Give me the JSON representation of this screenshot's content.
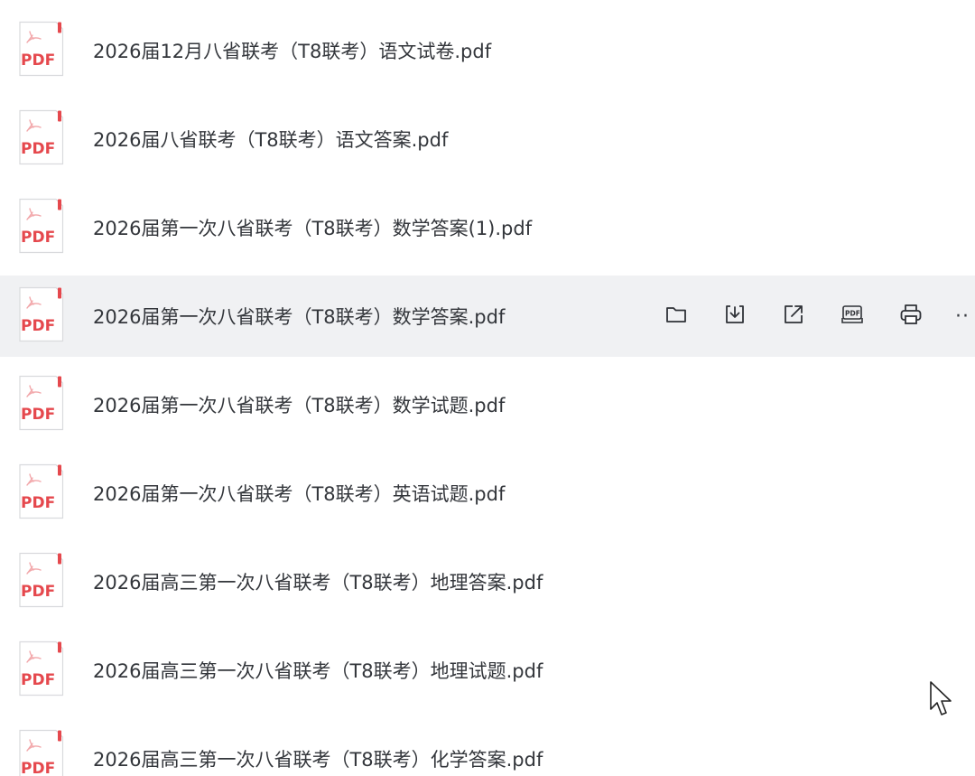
{
  "files": [
    {
      "name": "2026届12月八省联考（T8联考）语文试卷.pdf",
      "icon": "pdf-icon"
    },
    {
      "name": "2026届八省联考（T8联考）语文答案.pdf",
      "icon": "pdf-icon"
    },
    {
      "name": "2026届第一次八省联考（T8联考）数学答案(1).pdf",
      "icon": "pdf-icon"
    },
    {
      "name": "2026届第一次八省联考（T8联考）数学答案.pdf",
      "icon": "pdf-icon",
      "hovered": true
    },
    {
      "name": "2026届第一次八省联考（T8联考）数学试题.pdf",
      "icon": "pdf-icon"
    },
    {
      "name": "2026届第一次八省联考（T8联考）英语试题.pdf",
      "icon": "pdf-icon"
    },
    {
      "name": "2026届高三第一次八省联考（T8联考）地理答案.pdf",
      "icon": "pdf-icon"
    },
    {
      "name": "2026届高三第一次八省联考（T8联考）地理试题.pdf",
      "icon": "pdf-icon"
    },
    {
      "name": "2026届高三第一次八省联考（T8联考）化学答案.pdf",
      "icon": "pdf-icon"
    }
  ],
  "pdf_badge_text": "PDF",
  "row_actions": [
    {
      "name": "open-folder-button",
      "icon": "folder-icon"
    },
    {
      "name": "download-button",
      "icon": "download-icon"
    },
    {
      "name": "share-button",
      "icon": "external-link-icon"
    },
    {
      "name": "pdf-tools-button",
      "icon": "pdf-tools-icon",
      "label": "PDF"
    },
    {
      "name": "print-button",
      "icon": "printer-icon"
    }
  ],
  "more_label": "··",
  "colors": {
    "hover_bg": "#f0f1f3",
    "pdf_red": "#e5484d",
    "text": "#33363b",
    "icon_stroke": "#2f3237"
  }
}
